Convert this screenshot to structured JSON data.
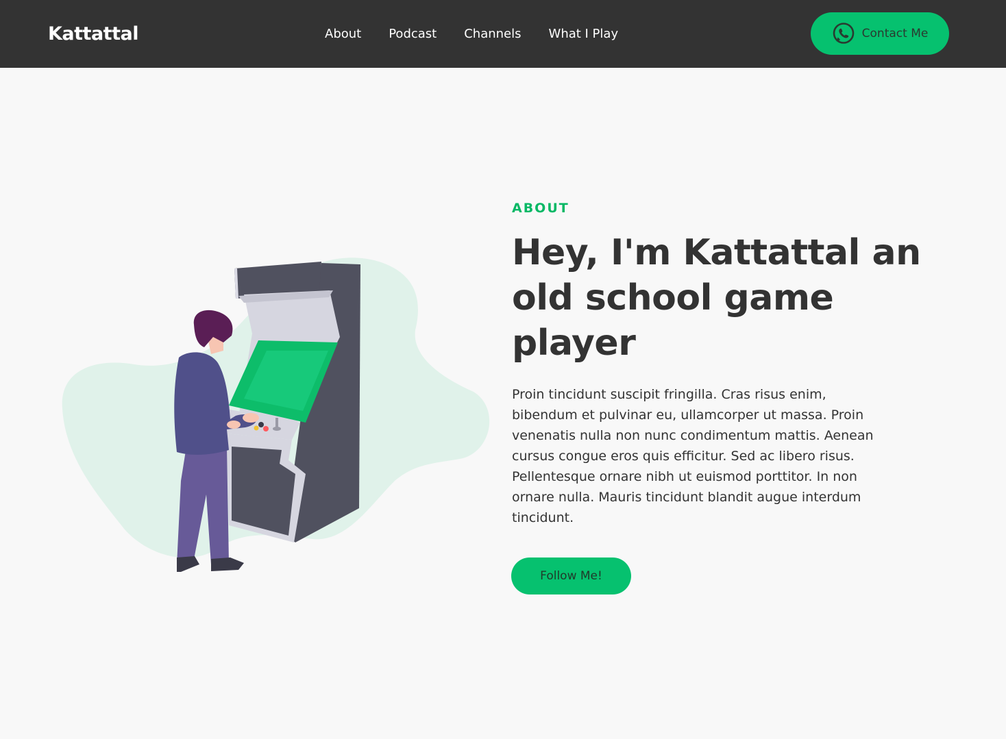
{
  "header": {
    "brand": "Kattattal",
    "nav": [
      {
        "label": "About"
      },
      {
        "label": "Podcast"
      },
      {
        "label": "Channels"
      },
      {
        "label": "What I Play"
      }
    ],
    "contact": {
      "label": "Contact Me",
      "icon": "whatsapp-icon"
    }
  },
  "hero": {
    "eyebrow": "ABOUT",
    "headline": "Hey, I'm Kattattal an old school game player",
    "body": "Proin tincidunt suscipit fringilla. Cras risus enim, bibendum et pulvinar eu, ullamcorper ut massa. Proin venenatis nulla non nunc condimentum mattis. Aenean cursus congue eros quis efficitur. Sed ac libero risus. Pellentesque ornare nibh ut euismod porttitor. In non ornare nulla. Mauris tincidunt blandit augue interdum tincidunt.",
    "cta": "Follow Me!",
    "illustration": "person-playing-arcade-illustration"
  },
  "colors": {
    "header_bg": "#333333",
    "page_bg": "#f8f8f8",
    "accent": "#06c16f",
    "eyebrow": "#06b865",
    "text": "#333333",
    "blob": "#e0f2ea"
  }
}
